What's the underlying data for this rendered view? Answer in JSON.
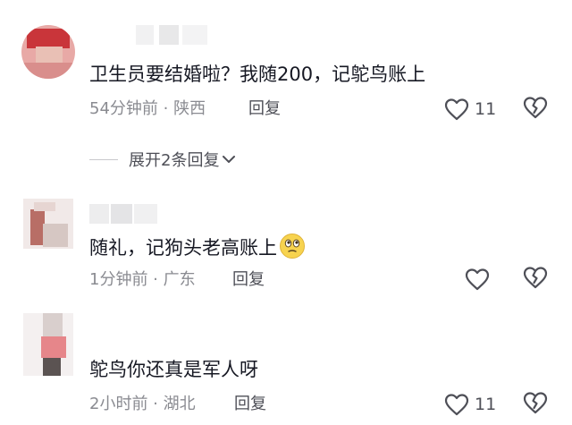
{
  "comments": [
    {
      "text": "卫生员要结婚啦？我随200，记鸵鸟账上",
      "meta": "54分钟前 · 陕西",
      "reply": "回复",
      "likes": "11",
      "like_icon": "heart-outline-icon",
      "dislike_icon": "broken-heart-icon"
    },
    {
      "text": "随礼，记狗头老高账上",
      "emoji": "thinking-face-emoji",
      "meta": "1分钟前 · 广东",
      "reply": "回复",
      "likes": "",
      "like_icon": "heart-outline-icon",
      "dislike_icon": "broken-heart-icon"
    },
    {
      "text": "鸵鸟你还真是军人呀",
      "meta": "2小时前 · 湖北",
      "reply": "回复",
      "likes": "11",
      "like_icon": "heart-outline-icon",
      "dislike_icon": "broken-heart-icon"
    }
  ],
  "expand_replies": {
    "label": "展开2条回复",
    "icon": "chevron-down-icon"
  },
  "colors": {
    "text_primary": "#161823",
    "text_secondary": "#8a8b91",
    "icon": "#4e4f57"
  }
}
